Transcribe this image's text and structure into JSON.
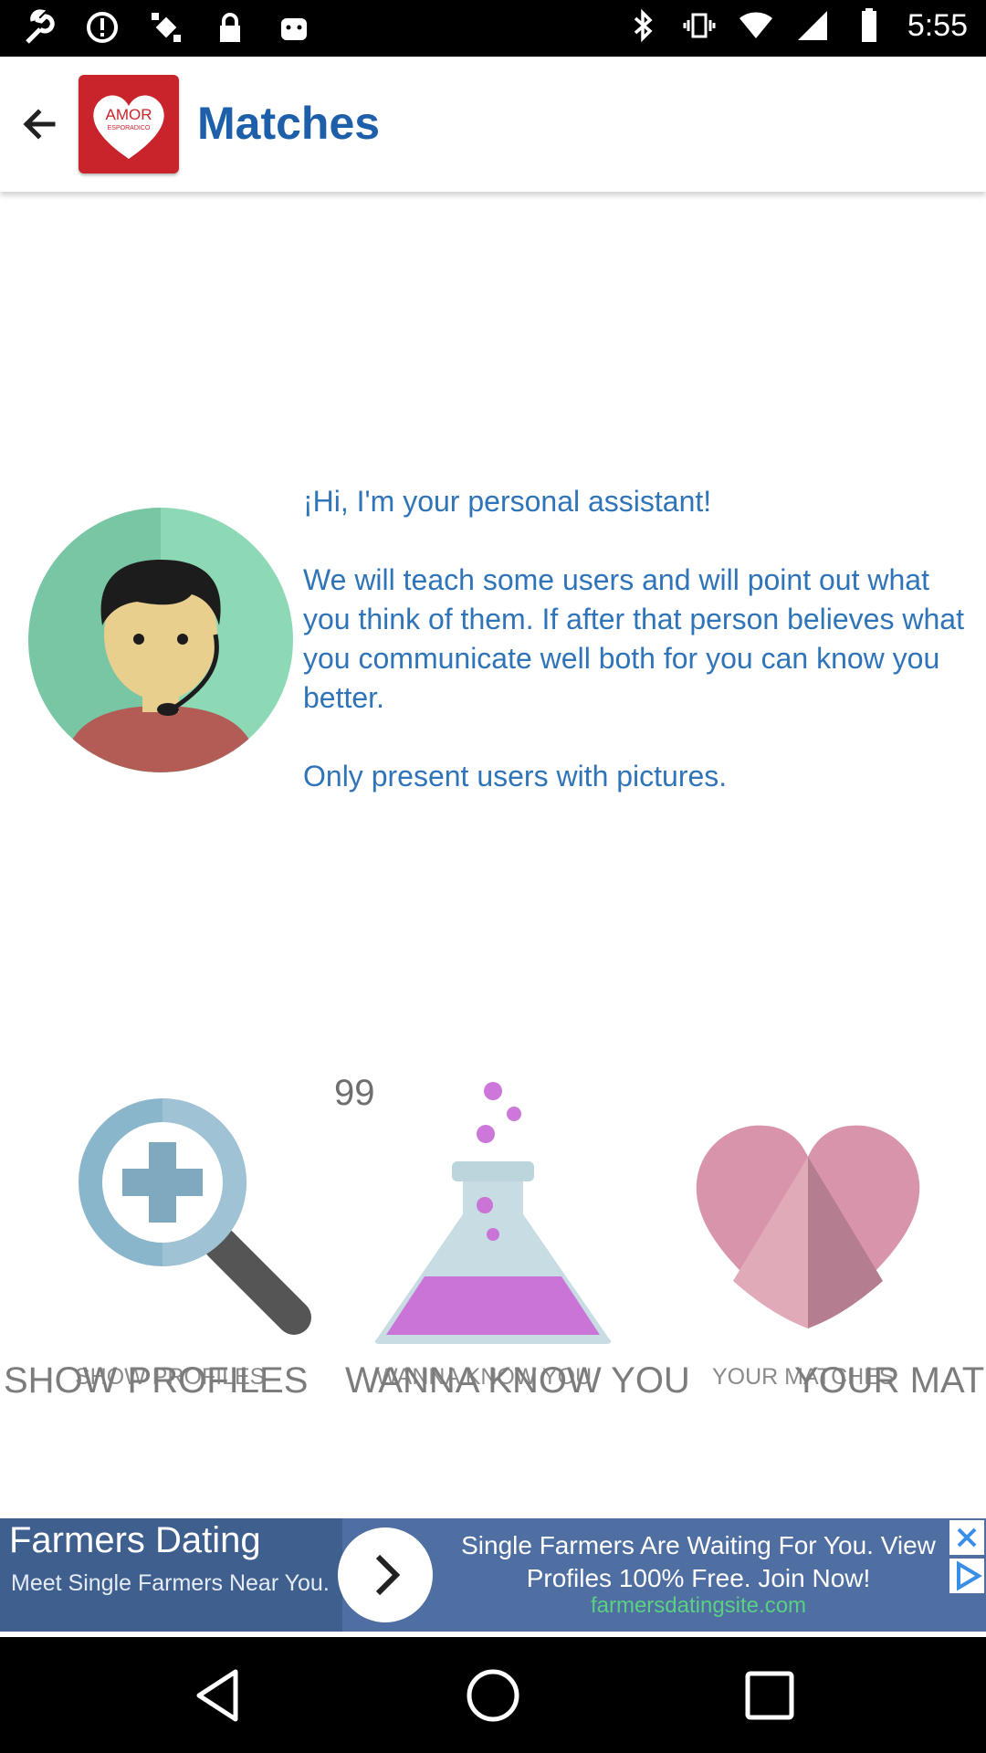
{
  "status_bar": {
    "time": "5:55",
    "left_icons": [
      "wrench-icon",
      "alert-icon",
      "fake-gps-icon",
      "lock-icon",
      "android-icon"
    ],
    "right_icons": [
      "bluetooth-icon",
      "vibrate-icon",
      "wifi-icon",
      "signal-icon",
      "battery-icon"
    ]
  },
  "app_bar": {
    "back_icon": "arrow-back-icon",
    "logo_text_top": "AMOR",
    "logo_text_bottom": "ESPORADICO",
    "title": "Matches"
  },
  "assistant": {
    "greeting": "¡Hi, I'm your personal assistant!",
    "body": "We will teach some users and will point out what you think of them. If after that person believes what you communicate well both for you can know you better.",
    "note": "Only present users with pictures."
  },
  "actions": {
    "count": "99",
    "items": [
      {
        "icon": "search-plus-icon",
        "label_small": "SHOW PROFILES",
        "label_big": "SHOW PROFILES"
      },
      {
        "icon": "flask-icon",
        "label_small": "WANNA KNOW YOU",
        "label_big": "WANNA KNOW YOU"
      },
      {
        "icon": "heart-icon",
        "label_small": "YOUR MATCHES",
        "label_big": "YOUR MAT"
      }
    ]
  },
  "ad": {
    "title": "Farmers Dating",
    "subtitle": "Meet Single Farmers Near You.",
    "text": "Single Farmers Are Waiting For You. View Profiles 100% Free. Join Now!",
    "domain": "farmersdatingsite.com"
  },
  "nav_bar": {
    "icons": [
      "back-triangle-icon",
      "home-circle-icon",
      "recents-square-icon"
    ]
  },
  "colors": {
    "accent": "#1d5fa8",
    "message_text": "#2f74b8",
    "logo_red": "#c9242c",
    "ad_blue": "#4f6fa2"
  }
}
